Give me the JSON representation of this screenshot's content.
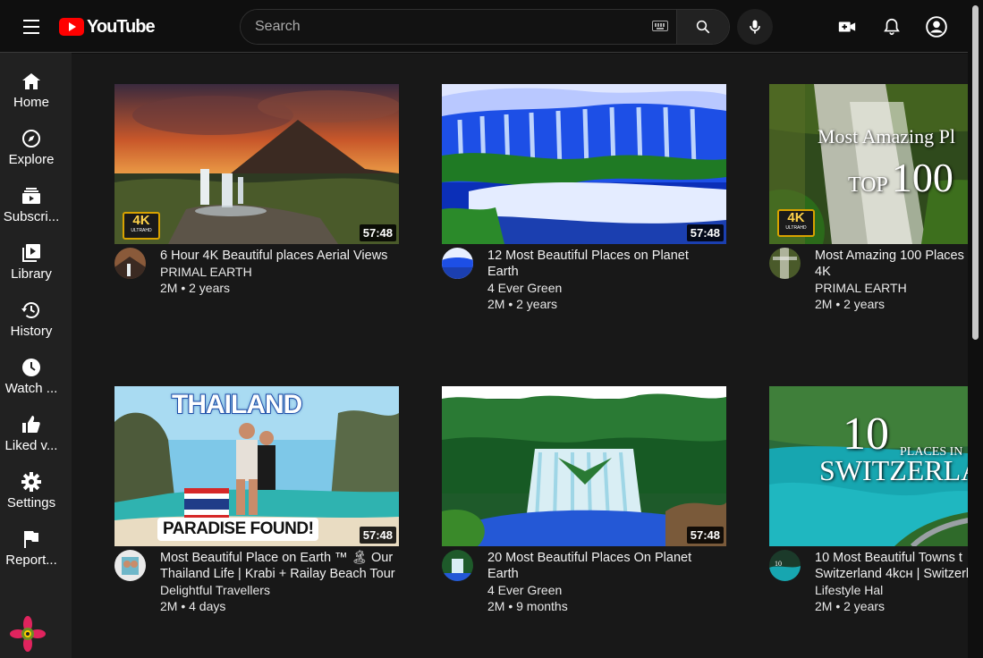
{
  "header": {
    "logo_text": "YouTube",
    "search_placeholder": "Search",
    "icons": [
      "menu-icon",
      "youtube-logo",
      "keyboard-icon",
      "search-icon",
      "microphone-icon",
      "create-video-icon",
      "notifications-bell-icon",
      "account-icon"
    ]
  },
  "sidebar": {
    "items": [
      {
        "label": "Home",
        "icon": "home-icon"
      },
      {
        "label": "Explore",
        "icon": "compass-icon"
      },
      {
        "label": "Subscri...",
        "icon": "subscriptions-icon"
      },
      {
        "label": "Library",
        "icon": "library-icon"
      },
      {
        "label": "History",
        "icon": "history-icon"
      },
      {
        "label": "Watch ...",
        "icon": "watch-later-icon"
      },
      {
        "label": "Liked v...",
        "icon": "thumbs-up-icon"
      },
      {
        "label": "Settings",
        "icon": "gear-icon"
      },
      {
        "label": "Report...",
        "icon": "flag-icon"
      }
    ]
  },
  "videos": [
    {
      "title_lines": [
        "6 Hour 4K Beautiful places Aerial Views"
      ],
      "channel": "PRIMAL EARTH",
      "stats": "2M • 2 years",
      "duration": "57:48",
      "badge": "4K",
      "badge_sub": "ULTRAHD"
    },
    {
      "title_lines": [
        "12 Most Beautiful Places on Planet",
        "Earth"
      ],
      "channel": "4 Ever Green",
      "stats": "2M • 2 years",
      "duration": "57:48"
    },
    {
      "title_lines": [
        "Most Amazing 100 Places",
        "4K"
      ],
      "channel": "PRIMAL EARTH",
      "stats": "2M • 2 years",
      "overlay_line1": "Most Amazing Pl",
      "overlay_line2a": "TOP",
      "overlay_line2b": "100",
      "badge": "4K",
      "badge_sub": "ULTRAHD"
    },
    {
      "title_lines": [
        "Most Beautiful Place on Earth ™ 🏝 Our",
        "Thailand Life | Krabi + Railay Beach Tour"
      ],
      "channel": "Delightful Travellers",
      "stats": "2M • 4 days",
      "duration": "57:48",
      "overlay_top": "THAILAND",
      "overlay_bottom": "PARADISE FOUND!"
    },
    {
      "title_lines": [
        "20 Most Beautiful Places On Planet",
        "Earth"
      ],
      "channel": "4 Ever Green",
      "stats": "2M • 9 months",
      "duration": "57:48"
    },
    {
      "title_lines": [
        "10 Most Beautiful Towns t",
        "Switzerland 4kᴄʜ | Switzerl"
      ],
      "channel": "Lifestyle Hal",
      "stats": "2M • 2 years",
      "overlay_big": "10",
      "overlay_small": "PLACES IN",
      "overlay_word": "SWITZERLA"
    }
  ],
  "colors": {
    "accent": "#ff0000",
    "background": "#0f0f0f",
    "sidebar": "#212121",
    "main": "#181818"
  }
}
